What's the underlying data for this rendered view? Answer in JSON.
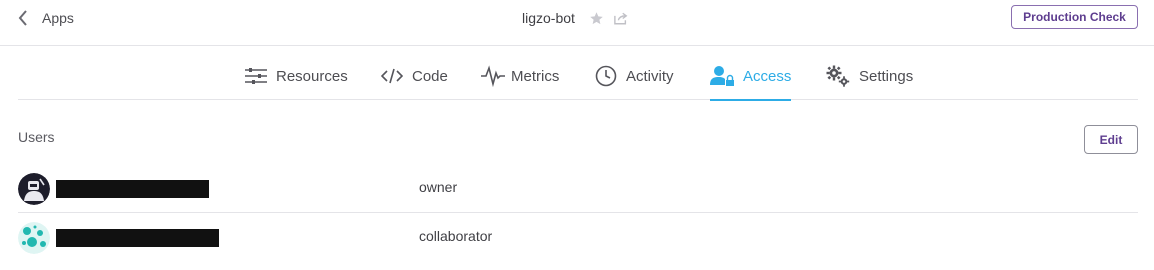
{
  "header": {
    "back_label": "Apps",
    "app_name": "ligzo-bot",
    "production_check_label": "Production Check"
  },
  "tabs": [
    {
      "label": "Resources",
      "icon": "sliders-icon",
      "active": false
    },
    {
      "label": "Code",
      "icon": "code-icon",
      "active": false
    },
    {
      "label": "Metrics",
      "icon": "pulse-icon",
      "active": false
    },
    {
      "label": "Activity",
      "icon": "clock-icon",
      "active": false
    },
    {
      "label": "Access",
      "icon": "user-lock-icon",
      "active": true
    },
    {
      "label": "Settings",
      "icon": "gears-icon",
      "active": false
    }
  ],
  "users": {
    "title": "Users",
    "edit_label": "Edit",
    "rows": [
      {
        "role": "owner",
        "avatar": "robot-avatar"
      },
      {
        "role": "collaborator",
        "avatar": "teal-pattern-avatar"
      }
    ]
  },
  "colors": {
    "accent": "#2dace6",
    "brand_purple": "#5e3d8f",
    "border": "#e4e4e8",
    "text": "#3f3f44"
  }
}
